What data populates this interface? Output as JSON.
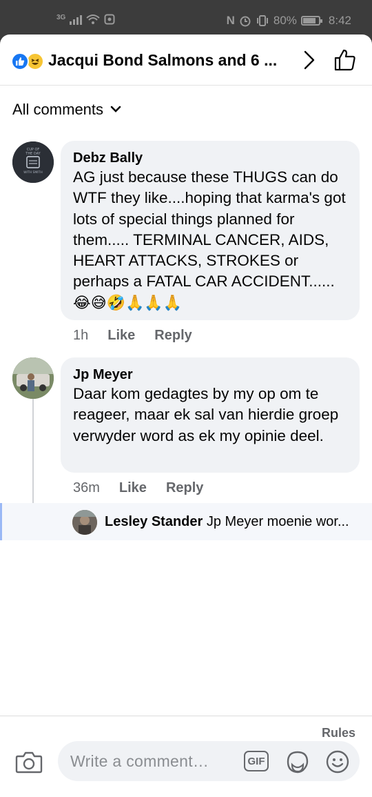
{
  "status_bar": {
    "network": "3G",
    "battery": "80%",
    "time": "8:42"
  },
  "header": {
    "title": "Jacqui Bond Salmons and 6 ...",
    "reactions": [
      "like-icon",
      "haha-icon"
    ]
  },
  "filter": {
    "label": "All comments"
  },
  "comments": [
    {
      "author": "Debz Bally",
      "text": "AG just because these THUGS can do WTF they like....hoping that karma's got lots of special things planned for them..... TERMINAL CANCER, AIDS, HEART ATTACKS, STROKES or perhaps a FATAL CAR ACCIDENT......",
      "emojis": "😂😅🤣🙏🙏🙏",
      "time": "1h",
      "like_label": "Like",
      "reply_label": "Reply"
    },
    {
      "author": "Jp Meyer",
      "text": "Daar kom gedagtes by my op om te reageer, maar ek sal van hierdie groep verwyder word as ek my opinie deel.",
      "time": "36m",
      "like_label": "Like",
      "reply_label": "Reply",
      "reply_preview": {
        "author": "Lesley Stander",
        "text": "Jp Meyer moenie wor..."
      }
    }
  ],
  "composer": {
    "rules_label": "Rules",
    "placeholder": "Write a comment…",
    "gif_label": "GIF"
  },
  "colors": {
    "accent": "#1877f2",
    "bubble": "#f0f2f5",
    "muted": "#65676b"
  }
}
